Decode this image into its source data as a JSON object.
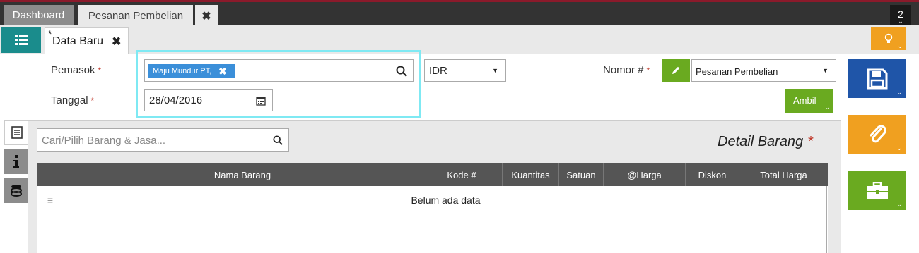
{
  "tabs": {
    "dashboard": "Dashboard",
    "pesanan": "Pesanan Pembelian",
    "close": "✖",
    "count": "2",
    "count_chevron": "⌄"
  },
  "subtabs": {
    "form_title": "Data Baru",
    "modified_marker": "*",
    "close": "✖"
  },
  "form": {
    "pemasok_label": "Pemasok",
    "tanggal_label": "Tanggal",
    "required_mark": "*",
    "pemasok_chip": "Maju Mundur PT,",
    "chip_remove": "✖",
    "tanggal_value": "28/04/2016",
    "currency": "IDR",
    "nomor_label": "Nomor #",
    "nomor_type": "Pesanan Pembelian",
    "ambil_label": "Ambil",
    "dropdown_caret": "▼",
    "chevron": "⌄"
  },
  "items": {
    "search_placeholder": "Cari/Pilih Barang & Jasa...",
    "title": "Detail Barang",
    "columns": [
      "Nama Barang",
      "Kode #",
      "Kuantitas",
      "Satuan",
      "@Harga",
      "Diskon",
      "Total Harga"
    ],
    "empty_text": "Belum ada data",
    "row_handle": "≡"
  },
  "colors": {
    "accent_teal": "#1a8c8c",
    "save_blue": "#1f55a8",
    "attach_orange": "#f0a020",
    "tools_green": "#6aaa20",
    "highlight": "#7fe9f3"
  },
  "icons": {
    "list": "list-icon",
    "bulb": "lightbulb-icon",
    "search": "search-icon",
    "calendar": "calendar-icon",
    "pencil": "pencil-icon",
    "save": "floppy-disk-icon",
    "attach": "paperclip-icon",
    "tools": "briefcase-icon",
    "details": "document-lines-icon",
    "info": "info-icon",
    "cost": "coins-icon"
  }
}
